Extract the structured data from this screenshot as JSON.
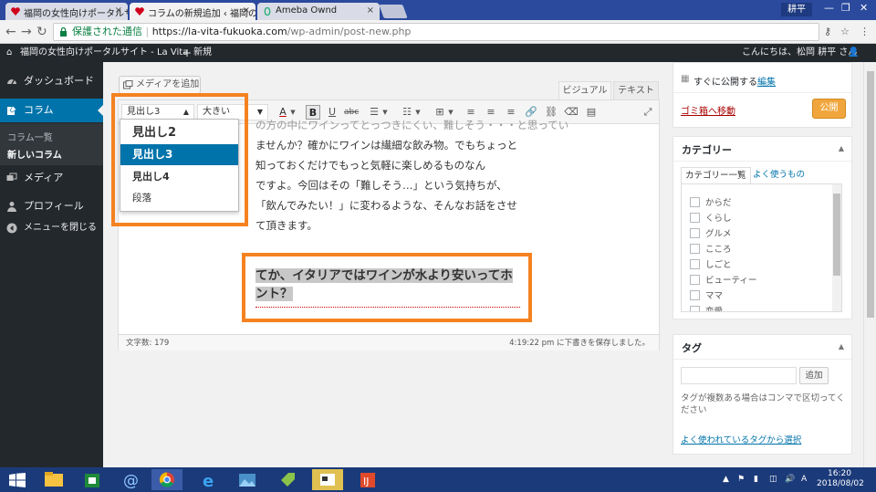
{
  "browser": {
    "tabs": [
      {
        "title": "福岡の女性向けポータルサ"
      },
      {
        "title": "コラムの新規追加 ‹ 福岡の"
      },
      {
        "title": "Ameba Ownd"
      }
    ],
    "close_glyph": "×",
    "profile_name": "耕平",
    "secure_label": "保護された通信",
    "url_host": "https://la-vita-fukuoka.com",
    "url_path": "/wp-admin/post-new.php"
  },
  "adminbar": {
    "site_name": "福岡の女性向けポータルサイト - La Vita",
    "new_label": "新規",
    "greeting": "こんにちは、松岡 耕平 さん"
  },
  "sidebar": {
    "items": [
      {
        "label": "ダッシュボード",
        "icon": "dashboard-icon"
      },
      {
        "label": "コラム",
        "icon": "pin-icon"
      },
      {
        "label": "メディア",
        "icon": "media-icon"
      },
      {
        "label": "プロフィール",
        "icon": "user-icon"
      },
      {
        "label": "メニューを閉じる",
        "icon": "collapse-icon"
      }
    ],
    "submenu": [
      {
        "label": "コラム一覧"
      },
      {
        "label": "新しいコラム"
      }
    ]
  },
  "editor": {
    "add_media_label": "メディアを追加",
    "visual_tab": "ビジュアル",
    "text_tab": "テキスト",
    "format_value": "見出し3",
    "fontsize_value": "大きい",
    "content_lines": [
      "の方の中にワインってとっつきにくい、難しそう・・・と思ってい",
      "ませんか？確かにワインは繊細な飲み物。でもちょっと",
      "知っておくだけでもっと気軽に楽しめるものなん",
      "ですよ。今回はその「難しそう…」という気持ちが、",
      "「飲んでみたい！」に変わるような、そんなお話をさせ",
      "て頂きます。"
    ],
    "heading_text": "てか、イタリアではワインが水より安いってホント？",
    "word_count": "文字数: 179",
    "autosave": "4:19:22 pm に下書きを保存しました。"
  },
  "format_dropdown": {
    "options": [
      {
        "label": "見出し2"
      },
      {
        "label": "見出し3"
      },
      {
        "label": "見出し4"
      },
      {
        "label": "段落"
      }
    ],
    "selected_index": 1
  },
  "publish": {
    "schedule_label": "すぐに公開する",
    "edit_link": "編集",
    "trash_link": "ゴミ箱へ移動",
    "publish_button": "公開"
  },
  "categories": {
    "title": "カテゴリー",
    "tab_all": "カテゴリー一覧",
    "tab_popular": "よく使うもの",
    "items": [
      {
        "label": "からだ"
      },
      {
        "label": "くらし"
      },
      {
        "label": "グルメ"
      },
      {
        "label": "こころ"
      },
      {
        "label": "しごと"
      },
      {
        "label": "ビューティー"
      },
      {
        "label": "ママ"
      },
      {
        "label": "恋愛"
      }
    ]
  },
  "tags": {
    "title": "タグ",
    "add_button": "追加",
    "help_text": "タグが複数ある場合はコンマで区切ってください",
    "popular_link": "よく使われているタグから選択"
  },
  "taskbar": {
    "time": "16:20",
    "date": "2018/08/02"
  },
  "colors": {
    "wp_blue": "#0073aa",
    "wp_dark": "#23282d",
    "annotation_orange": "#f58220",
    "publish_orange": "#f0a63c",
    "trash_red": "#a00"
  }
}
